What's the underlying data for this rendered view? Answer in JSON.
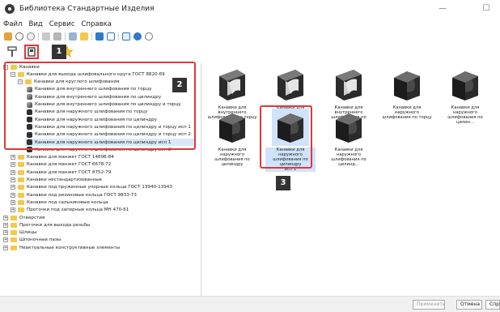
{
  "window": {
    "title": "Библиотека Стандартные Изделия",
    "minimize_glyph": "—",
    "maximize_glyph": "☐"
  },
  "menu": [
    "Файл",
    "Вид",
    "Сервис",
    "Справка"
  ],
  "toolbar_icons": [
    "open-icon",
    "search-icon",
    "filter-icon",
    "copy-icon",
    "paste-icon",
    "properties-icon",
    "folder-icon",
    "thumbnails-view-icon",
    "list-view-icon",
    "table-view-icon",
    "help-icon",
    "zoom-icon"
  ],
  "tabs": {
    "tab1_icon": "catalog-icon",
    "tab2_icon": "library-book-icon",
    "tab3_icon": "favorites-star-icon"
  },
  "callouts": [
    "1",
    "2",
    "3"
  ],
  "tree": [
    {
      "text": "Канавки",
      "level": 0,
      "expanded": true,
      "icon": "folder"
    },
    {
      "text": "Канавки для выхода шлифовального круга ГОСТ 8820-69",
      "level": 1,
      "expanded": true,
      "icon": "folder"
    },
    {
      "text": "Канавки для круглого шлифования",
      "level": 2,
      "expanded": true,
      "icon": "folder"
    },
    {
      "text": "Канавки для внутреннего шлифования по торцу",
      "level": 3,
      "icon": "inner"
    },
    {
      "text": "Канавки для внутреннего шлифования по цилиндру",
      "level": 3,
      "icon": "inner"
    },
    {
      "text": "Канавки для внутреннего шлифования по цилиндру и торцу",
      "level": 3,
      "icon": "inner"
    },
    {
      "text": "Канавки для наружного шлифования по торцу",
      "level": 3,
      "icon": "outer"
    },
    {
      "text": "Канавки для наружного шлифования по цилиндру",
      "level": 3,
      "icon": "outer"
    },
    {
      "text": "Канавки для наружного шлифования по цилиндру и торцу исп 1",
      "level": 3,
      "icon": "outer"
    },
    {
      "text": "Канавки для наружного шлифования по цилиндру и торцу исп 2",
      "level": 3,
      "icon": "outer"
    },
    {
      "text": "Канавки для наружного шлифования по цилиндру исп 1",
      "level": 3,
      "icon": "outer",
      "selected": true
    },
    {
      "text": "Канавки для наружного шлифования по цилиндру исп 2",
      "level": 3,
      "icon": "outer"
    },
    {
      "text": "Канавки для манжет ГОСТ 14896-84",
      "level": 1,
      "expanded": false,
      "icon": "folder"
    },
    {
      "text": "Канавки для манжет ГОСТ 6678-72",
      "level": 1,
      "expanded": false,
      "icon": "folder"
    },
    {
      "text": "Канавки для манжет ГОСТ 8752-79",
      "level": 1,
      "expanded": false,
      "icon": "folder"
    },
    {
      "text": "Канавки нестандартизованные",
      "level": 1,
      "expanded": false,
      "icon": "folder"
    },
    {
      "text": "Канавки под пружинные упорные кольца ГОСТ 13940-13943",
      "level": 1,
      "expanded": false,
      "icon": "folder"
    },
    {
      "text": "Канавки под резиновые кольца ГОСТ 9833-73",
      "level": 1,
      "expanded": false,
      "icon": "folder"
    },
    {
      "text": "Канавки под сальниковые кольца",
      "level": 1,
      "expanded": false,
      "icon": "folder"
    },
    {
      "text": "Проточки под запорные кольца МН 470-61",
      "level": 1,
      "expanded": false,
      "icon": "folder"
    },
    {
      "text": "Отверстия",
      "level": 0,
      "expanded": false,
      "icon": "folder"
    },
    {
      "text": "Проточки для выхода резьбы",
      "level": 0,
      "expanded": false,
      "icon": "folder"
    },
    {
      "text": "Шлицы",
      "level": 0,
      "expanded": false,
      "icon": "folder"
    },
    {
      "text": "Шпоночные пазы",
      "level": 0,
      "expanded": false,
      "icon": "folder"
    },
    {
      "text": "Неактуальные конструктивные элементы",
      "level": 0,
      "expanded": false,
      "icon": "folder"
    }
  ],
  "thumbnails": [
    {
      "caption1": "Канавки для внутреннего",
      "caption2": "шлифования по торцу",
      "caption3": "",
      "kind": "inner"
    },
    {
      "caption1": "Канавки для внутреннего",
      "caption2": "шлифования по цилиндру",
      "caption3": "",
      "kind": "inner"
    },
    {
      "caption1": "Канавки для внутреннего",
      "caption2": "шлифования по цилиндр...",
      "caption3": "",
      "kind": "inner"
    },
    {
      "caption1": "Канавки для наружного",
      "caption2": "шлифования по торцу",
      "caption3": "",
      "kind": "outer"
    },
    {
      "caption1": "Канавки для наружного",
      "caption2": "шлифования по цилин...",
      "caption3": "",
      "kind": "outer"
    },
    {
      "caption1": "Канавки для наружного",
      "caption2": "шлифования по цилиндру",
      "caption3": "",
      "kind": "outer"
    },
    {
      "caption1": "Канавки для наружного",
      "caption2": "шлифования по цилиндру",
      "caption3": "исп 1",
      "kind": "outer",
      "selected": true
    },
    {
      "caption1": "Канавки для наружного",
      "caption2": "шлифования по цилинд...",
      "caption3": "",
      "kind": "outer"
    }
  ],
  "footer": {
    "apply": "Применить",
    "cancel": "Отмена",
    "extra": "Спр"
  },
  "colors": {
    "highlight_red": "#e0383b",
    "selection_blue": "#cfe3fb",
    "folder_yellow": "#f2c94c"
  }
}
